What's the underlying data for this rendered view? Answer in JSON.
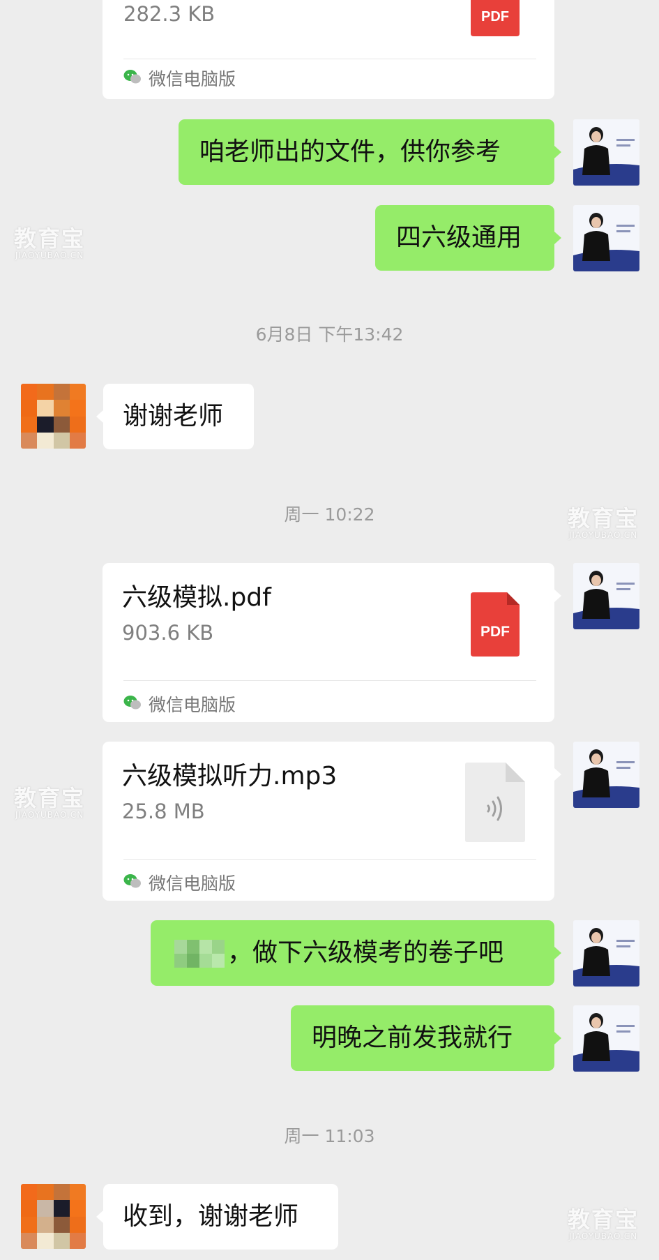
{
  "messages": {
    "file_top": {
      "size": "282.3 KB",
      "source": "微信电脑版",
      "icon_label": "PDF"
    },
    "teacher_msg_1": "咱老师出的文件，供你参考",
    "teacher_msg_2": "四六级通用",
    "time_1": "6月8日 下午13:42",
    "student_msg_1": "谢谢老师",
    "time_2": "周一 10:22",
    "file_pdf": {
      "name": "六级模拟.pdf",
      "size": "903.6 KB",
      "source": "微信电脑版",
      "icon_label": "PDF"
    },
    "file_mp3": {
      "name": "六级模拟听力.mp3",
      "size": "25.8 MB",
      "source": "微信电脑版"
    },
    "teacher_msg_3": "，做下六级模考的卷子吧",
    "teacher_msg_4": "明晚之前发我就行",
    "time_3": "周一 11:03",
    "student_msg_2": "收到，谢谢老师"
  },
  "watermark": {
    "cn": "教育宝",
    "en": "JIAOYUBAO.CN"
  },
  "colors": {
    "background": "#ededed",
    "bubble_green": "#95ec69",
    "bubble_white": "#ffffff",
    "pdf_red": "#e8403a"
  },
  "icons": [
    "wechat-icon",
    "pdf-file-icon",
    "audio-file-icon"
  ]
}
